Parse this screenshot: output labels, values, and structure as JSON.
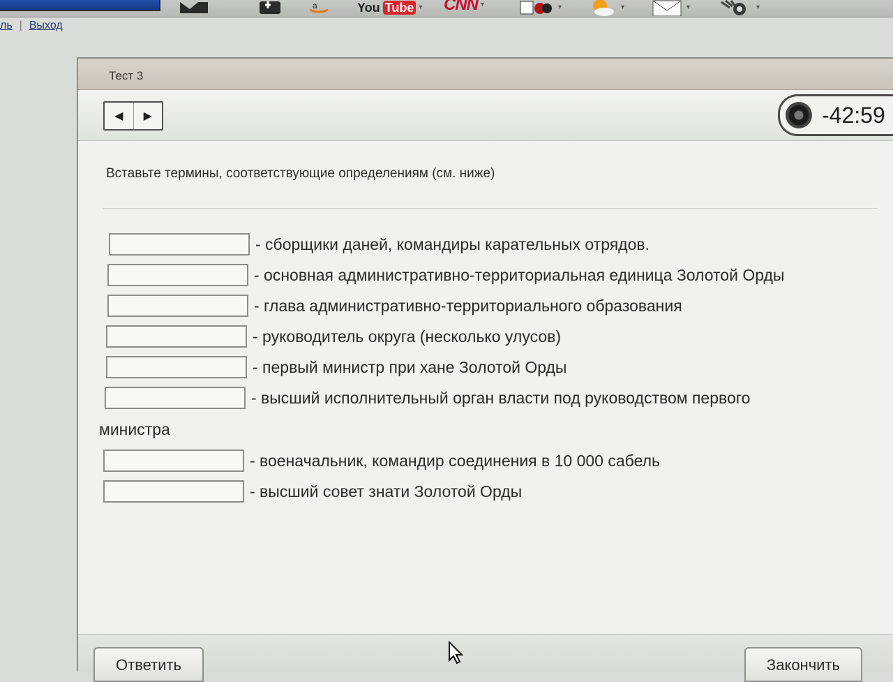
{
  "browser": {
    "nav_links": [
      "ль",
      "Выход"
    ],
    "toolbar_icons": [
      "bookmark-icon",
      "plus-icon",
      "amazon-icon",
      "youtube-icon",
      "cnn-icon",
      "games-icon",
      "weather-icon",
      "mail-icon",
      "hand-icon"
    ],
    "youtube_you": "You",
    "youtube_tube": "Tube",
    "cnn_label": "CNN"
  },
  "window": {
    "title": "Тест 3",
    "timer": "-42:59"
  },
  "question": {
    "instruction": "Вставьте термины, соответствующие определениям (см. ниже)",
    "items": [
      {
        "definition": "- сборщики даней, командиры карательных отрядов."
      },
      {
        "definition": "- основная административно-территориальная единица Золотой Орды"
      },
      {
        "definition": "- глава административно-территориального образования"
      },
      {
        "definition": "- руководитель округа (несколько улусов)"
      },
      {
        "definition": "- первый министр при хане Золотой Орды"
      },
      {
        "definition": "- высший исполнительный орган власти под руководством первого"
      },
      {
        "definition": "- военачальник, командир соединения в 10 000 сабель"
      },
      {
        "definition": "- высший совет знати Золотой Орды"
      }
    ],
    "wrap_text": "министра"
  },
  "buttons": {
    "answer": "Ответить",
    "finish": "Закончить"
  }
}
